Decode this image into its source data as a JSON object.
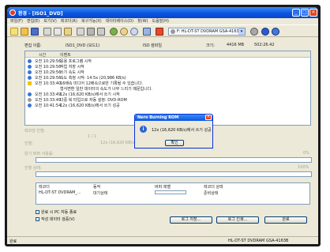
{
  "window": {
    "title": "환경 - [ISO1_DVD]"
  },
  "menu": [
    "파일(F)",
    "편집(E)",
    "보기(V)",
    "레코더(R)",
    "복구가능(X)",
    "데이터베이스(D)",
    "창(W)",
    "도움말(H)"
  ],
  "toolbar": {
    "drive": "F: HL-DT-ST DVDRAM GSA-4163B"
  },
  "info": {
    "name_label": "편집 이름:",
    "name_value": "ISO1_DVD (모드1)",
    "format": "ISO 컴파일",
    "size_label": "크기:",
    "size_value": "4416 MB",
    "capacity": "502:26.42"
  },
  "log": {
    "headers": [
      "시간",
      "이벤트"
    ],
    "rows": [
      {
        "icon": "info",
        "time": "오전 10:29:56",
        "msg": "응용 프로그램 시작"
      },
      {
        "icon": "info",
        "time": "오전 10:29:56",
        "msg": "작업 저장 시작"
      },
      {
        "icon": "info",
        "time": "오전 10:29:56",
        "msg": "쓰기 속도 시작"
      },
      {
        "icon": "info",
        "time": "오전 10:29:56",
        "msg": "속도 측정 시작: 14.5x (20,986 KB/s)"
      },
      {
        "icon": "warn",
        "time": "오전 10:33:40",
        "msg": "16배속 미디어 12배속으로만 기록될 수 있습니다."
      },
      {
        "icon": "none",
        "time": "",
        "msg": "형식변환 일반 데이터의 속도가 너무 느리기 때문입니다."
      },
      {
        "icon": "info",
        "time": "오전 10:33:49",
        "msg": "12x (16,620 KB/s)에서 쓰기 시작"
      },
      {
        "icon": "disc",
        "time": "오전 10:33:49",
        "msg": "다중 복 타입으로 자동 설정: DVD-ROM"
      },
      {
        "icon": "info",
        "time": "오전 10:41:54",
        "msg": "12x (16,620 KB/s)에서 쓰기 성공"
      }
    ]
  },
  "status": {
    "step_label": "레코딩 진행:",
    "step_value": "1 / 1",
    "progress_label": "진행:",
    "progress_value": "12x (16,620 KB/s)",
    "buffer_label": "읽기 버퍼 사용률:",
    "buffer_pct": "0%",
    "write_label": "진행 상태:",
    "write_pct": "100%"
  },
  "drives": {
    "headers": [
      "레코더",
      "동작",
      "버퍼 레벨",
      "레코더 상태"
    ],
    "rows": [
      {
        "recorder": "HL-DT-ST DVDRAM_...",
        "action": "대기상태",
        "status": "준비상태"
      }
    ]
  },
  "options": {
    "shutdown": "완료 시 PC 자동 종료",
    "verify": "작성 데이터 검증(V)"
  },
  "buttons": {
    "save_log": "로그 저장...",
    "print_log": "로그 인쇄...",
    "done": "완료"
  },
  "statusbar": {
    "left": "완료",
    "right": "HL-DT-ST DVDRAM GSA-4163B"
  },
  "dialog": {
    "title": "Nero Burning ROM",
    "message": "12x (16,620 KB/s)에서 쓰기 성공",
    "ok": "확인"
  }
}
